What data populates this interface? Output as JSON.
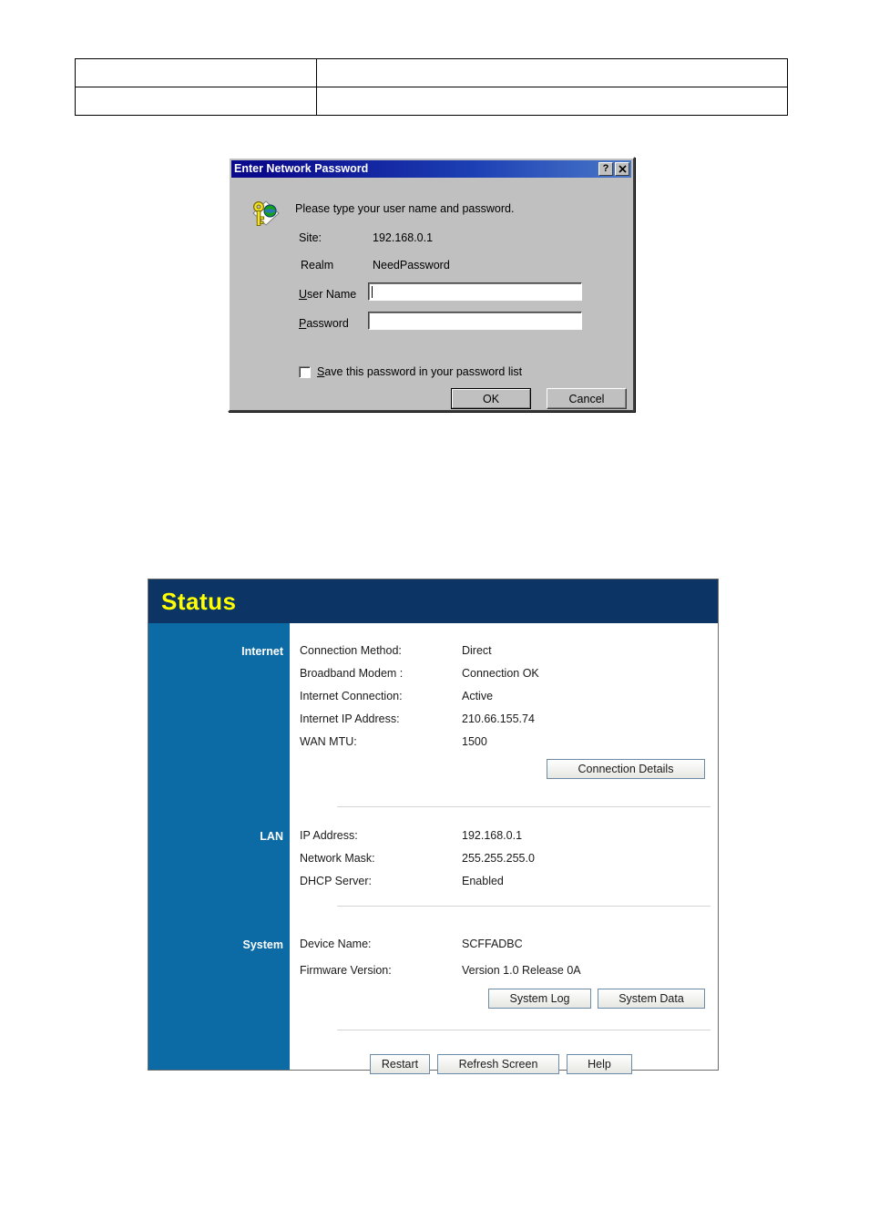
{
  "doc_table": {
    "rows": [
      {
        "cells": [
          "",
          ""
        ]
      },
      {
        "cells": [
          "",
          ""
        ]
      }
    ]
  },
  "password_dialog": {
    "title": "Enter Network Password",
    "help_button": "?",
    "close_button": "✕",
    "icon": "key-globe-icon",
    "prompt": "Please type your user name and password.",
    "fields": [
      {
        "label": "Site:",
        "value": "192.168.0.1"
      },
      {
        "label": "Realm",
        "value": "NeedPassword"
      }
    ],
    "user_name_label": "User Name",
    "user_name_value": "",
    "password_label": "Password",
    "password_value": "",
    "save_checkbox_label": "Save this password in your password list",
    "save_checkbox_checked": false,
    "ok_label": "OK",
    "cancel_label": "Cancel"
  },
  "status_page": {
    "title": "Status",
    "colors": {
      "header_bg": "#0c3464",
      "header_text": "#ffff00",
      "sidebar_bg": "#0c6aa5",
      "content_bg": "#ffffff",
      "panel_border": "#6b6b6b"
    },
    "sections": [
      {
        "name": "Internet",
        "rows": [
          {
            "label": "Connection Method:",
            "value": "Direct"
          },
          {
            "label": "Broadband Modem :",
            "value": "Connection OK"
          },
          {
            "label": "Internet Connection:",
            "value": "Active"
          },
          {
            "label": "Internet IP Address:",
            "value": "210.66.155.74"
          },
          {
            "label": "WAN MTU:",
            "value": "1500"
          }
        ],
        "buttons": [
          "Connection Details"
        ]
      },
      {
        "name": "LAN",
        "rows": [
          {
            "label": "IP Address:",
            "value": "192.168.0.1"
          },
          {
            "label": "Network Mask:",
            "value": "255.255.255.0"
          },
          {
            "label": "DHCP Server:",
            "value": "Enabled"
          }
        ],
        "buttons": []
      },
      {
        "name": "System",
        "rows": [
          {
            "label": "Device Name:",
            "value": "SCFFADBC"
          },
          {
            "label": "Firmware Version:",
            "value": "Version 1.0 Release 0A"
          }
        ],
        "buttons": [
          "System Log",
          "System Data"
        ]
      }
    ],
    "footer_buttons": [
      "Restart",
      "Refresh Screen",
      "Help"
    ]
  }
}
